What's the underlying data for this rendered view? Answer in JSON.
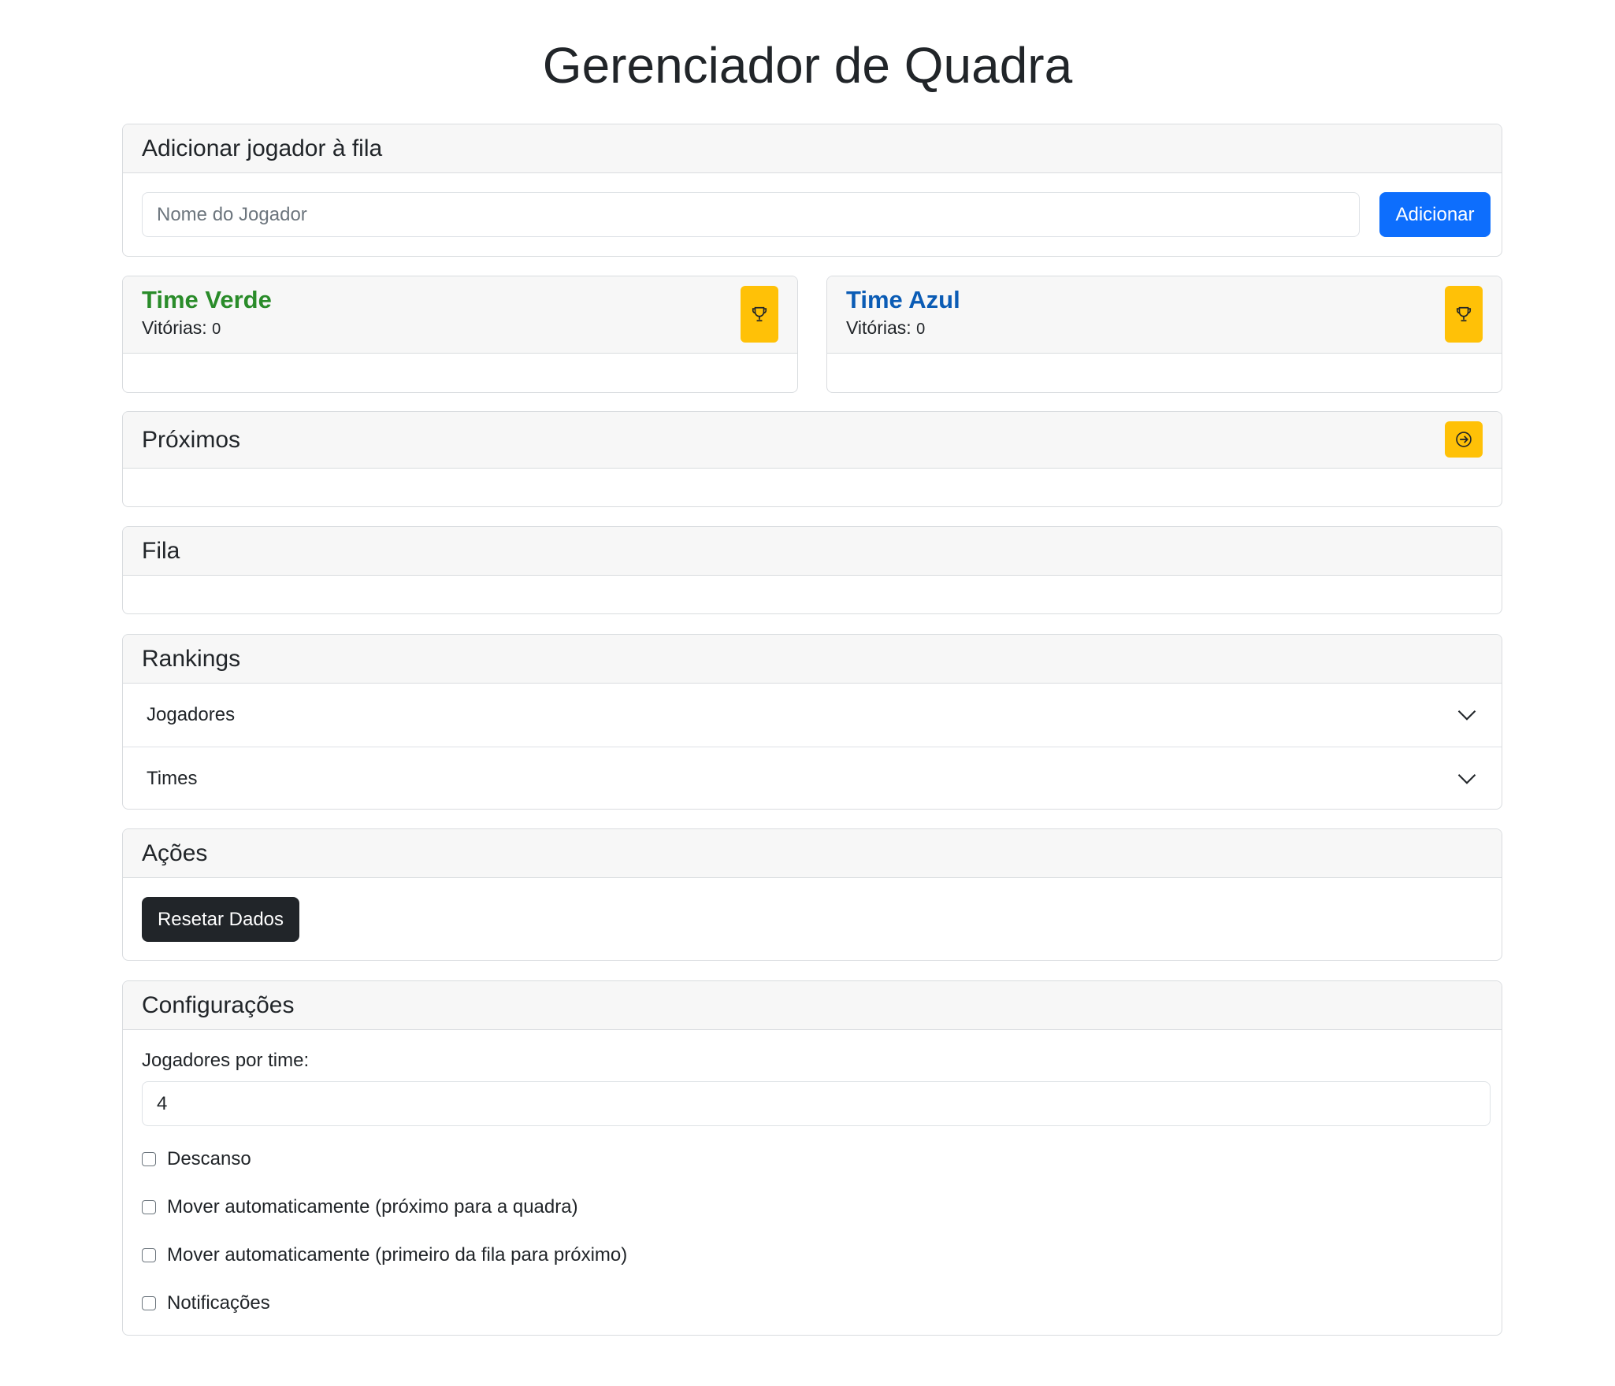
{
  "page_title": "Gerenciador de Quadra",
  "add_player": {
    "header": "Adicionar jogador à fila",
    "input_placeholder": "Nome do Jogador",
    "button_label": "Adicionar"
  },
  "teams": [
    {
      "name": "Time Verde",
      "wins_label": "Vitórias:",
      "wins": "0",
      "color": "#2a8c2a",
      "icon": "trophy-icon"
    },
    {
      "name": "Time Azul",
      "wins_label": "Vitórias:",
      "wins": "0",
      "color": "#0b5cb5",
      "icon": "trophy-icon"
    }
  ],
  "next": {
    "header": "Próximos",
    "icon": "arrow-right-circle-icon"
  },
  "queue": {
    "header": "Fila"
  },
  "rankings": {
    "header": "Rankings",
    "items": [
      {
        "label": "Jogadores",
        "icon": "chevron-down-icon"
      },
      {
        "label": "Times",
        "icon": "chevron-down-icon"
      }
    ]
  },
  "actions": {
    "header": "Ações",
    "reset_label": "Resetar Dados"
  },
  "settings": {
    "header": "Configurações",
    "players_per_team_label": "Jogadores por time:",
    "players_per_team_value": "4",
    "options": [
      {
        "label": "Descanso",
        "checked": false
      },
      {
        "label": "Mover automaticamente (próximo para a quadra)",
        "checked": false
      },
      {
        "label": "Mover automaticamente (primeiro da fila para próximo)",
        "checked": false
      },
      {
        "label": "Notificações",
        "checked": false
      }
    ]
  },
  "colors": {
    "primary": "#0d6efd",
    "warning": "#ffc107",
    "dark": "#212529"
  }
}
